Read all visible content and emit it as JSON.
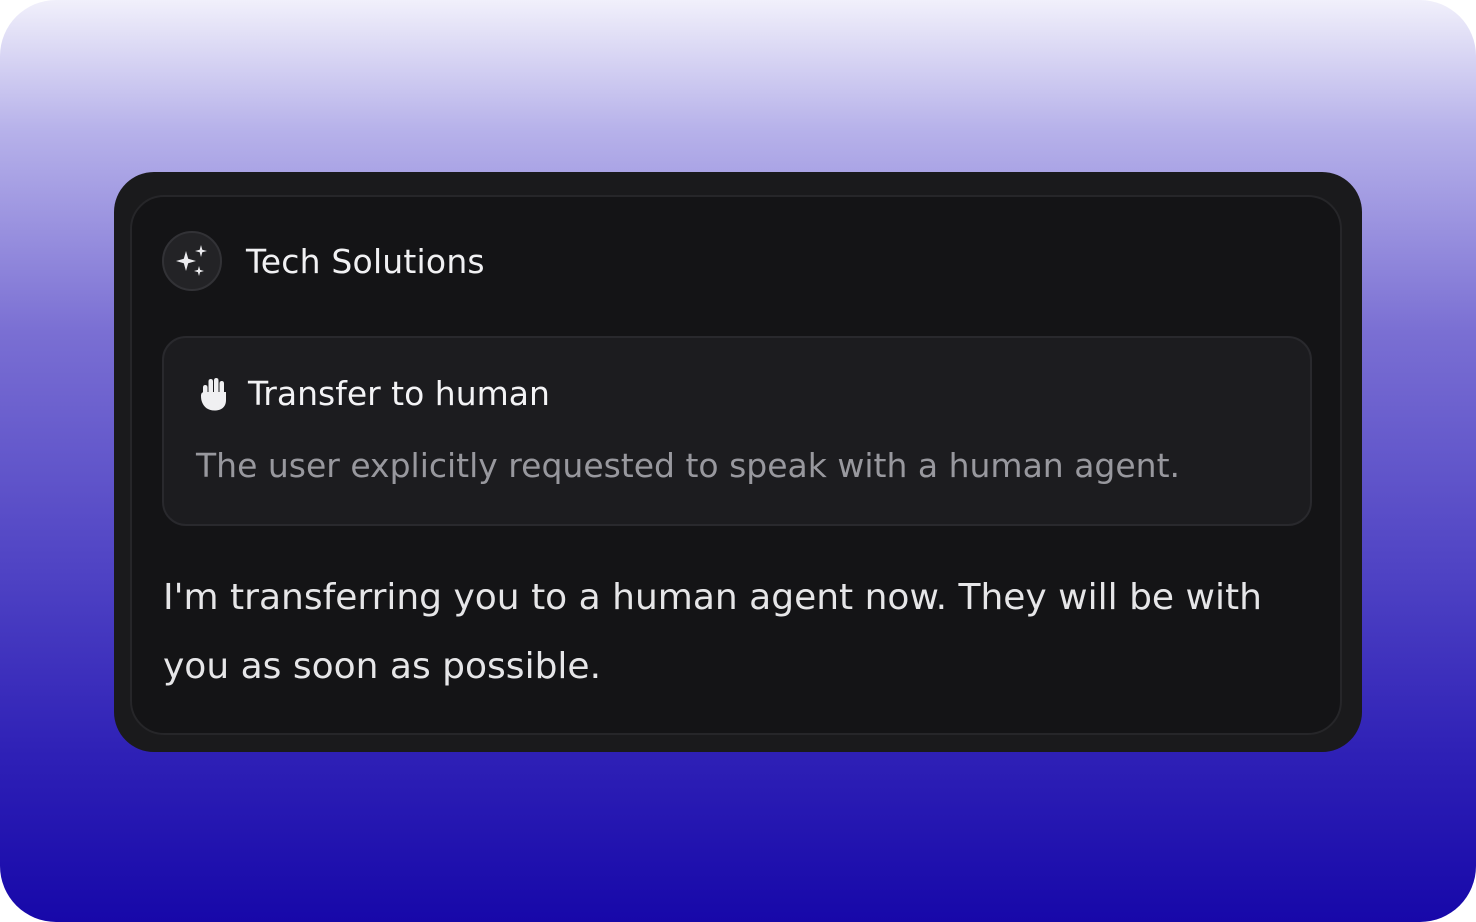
{
  "assistant": {
    "name": "Tech Solutions",
    "avatar_icon": "sparkles-icon"
  },
  "tool_call": {
    "icon": "hand-icon",
    "title": "Transfer to human",
    "description": "The user explicitly requested to speak with a human agent."
  },
  "message": {
    "text": "I'm transferring you to a human agent now. They will be with you as soon as possible."
  },
  "colors": {
    "background_top": "#f1f0fb",
    "background_bottom": "#1708a9",
    "card": "#141416",
    "tool_card": "#1c1c1f",
    "text_primary": "#f1f1f3",
    "text_muted": "#98989e"
  }
}
